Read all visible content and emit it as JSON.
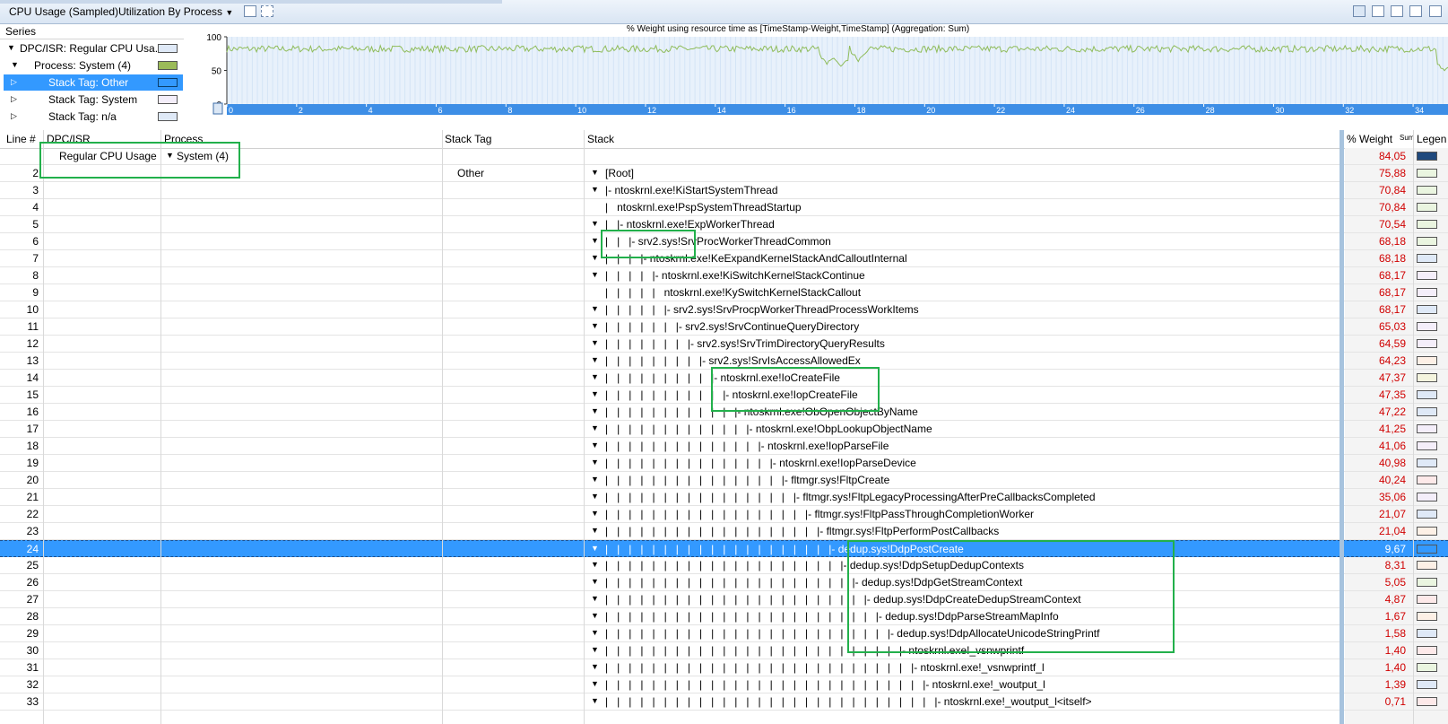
{
  "toolbar": {
    "graph_title": "CPU Usage (Sampled)",
    "preset": "Utilization By Process",
    "preset_arrow": "▼"
  },
  "series": {
    "header": "Series",
    "items": [
      {
        "label": "DPC/ISR: Regular CPU Usa...",
        "color": "#dfe9f7",
        "expander": "▼",
        "indent": 0
      },
      {
        "label": "Process: System (4)",
        "color": "#9bbb59",
        "expander": "▼",
        "indent": 1
      },
      {
        "label": "Stack Tag: Other",
        "color": "#3399ff",
        "expander": "▷",
        "indent": 2,
        "selected": true
      },
      {
        "label": "Stack Tag: System",
        "color": "#f4eefa",
        "expander": "▷",
        "indent": 2
      },
      {
        "label": "Stack Tag: n/a",
        "color": "#dfe9f7",
        "expander": "▷",
        "indent": 2
      }
    ]
  },
  "chart_data": {
    "type": "line",
    "title": "% Weight using resource time as [TimeStamp-Weight,TimeStamp] (Aggregation: Sum)",
    "ylim": [
      0,
      100
    ],
    "yticks": [
      0,
      50,
      100
    ],
    "xlim": [
      0,
      35
    ],
    "xticks": [
      0,
      2,
      4,
      6,
      8,
      10,
      12,
      14,
      16,
      18,
      20,
      22,
      24,
      26,
      28,
      30,
      32,
      34
    ],
    "line_color": "#8fbc5a",
    "baseline": 82,
    "dips": [
      {
        "x": 17.2,
        "y": 58
      },
      {
        "x": 17.6,
        "y": 52
      },
      {
        "x": 18.1,
        "y": 63
      },
      {
        "x": 34.9,
        "y": 45
      }
    ]
  },
  "columns": {
    "line": "Line #",
    "dpc": "DPC/ISR",
    "process": "Process",
    "stacktag": "Stack Tag",
    "stack": "Stack",
    "weight": "% Weight",
    "weight_sub": "Sum",
    "legend": "Legen"
  },
  "rows": [
    {
      "line": "",
      "dpc": "Regular CPU Usage",
      "process": "System (4)",
      "stacktag": "",
      "stack": "",
      "depth": 0,
      "exp": false,
      "weight": "84,05",
      "color": "#1f497d"
    },
    {
      "line": "2",
      "dpc": "",
      "process": "",
      "stacktag": "Other",
      "stack": "[Root]",
      "depth": 0,
      "exp": true,
      "weight": "75,88",
      "color": "#eaf5e0"
    },
    {
      "line": "3",
      "stack": "|- ntoskrnl.exe!KiStartSystemThread",
      "depth": 0,
      "exp": true,
      "weight": "70,84",
      "color": "#eaf5e0"
    },
    {
      "line": "4",
      "stack": "|   ntoskrnl.exe!PspSystemThreadStartup",
      "depth": 0,
      "exp": false,
      "weight": "70,84",
      "color": "#eaf5e0"
    },
    {
      "line": "5",
      "stack": "|   |- ntoskrnl.exe!ExpWorkerThread",
      "depth": 0,
      "exp": true,
      "weight": "70,54",
      "color": "#eaf5e0"
    },
    {
      "line": "6",
      "stack": "|   |   |- srv2.sys!SrvProcWorkerThreadCommon",
      "depth": 0,
      "exp": true,
      "weight": "68,18",
      "color": "#eaf5e0"
    },
    {
      "line": "7",
      "stack": "|   |   |   |- ntoskrnl.exe!KeExpandKernelStackAndCalloutInternal",
      "depth": 0,
      "exp": true,
      "weight": "68,18",
      "color": "#dfe9f7"
    },
    {
      "line": "8",
      "stack": "|   |   |   |   |- ntoskrnl.exe!KiSwitchKernelStackContinue",
      "depth": 0,
      "exp": true,
      "weight": "68,17",
      "color": "#f4eefa"
    },
    {
      "line": "9",
      "stack": "|   |   |   |   |   ntoskrnl.exe!KySwitchKernelStackCallout",
      "depth": 0,
      "exp": false,
      "weight": "68,17",
      "color": "#f4eefa"
    },
    {
      "line": "10",
      "stack": "|   |   |   |   |   |- srv2.sys!SrvProcpWorkerThreadProcessWorkItems",
      "depth": 0,
      "exp": true,
      "weight": "68,17",
      "color": "#dfe9f7"
    },
    {
      "line": "11",
      "stack": "|   |   |   |   |   |   |- srv2.sys!SrvContinueQueryDirectory",
      "depth": 0,
      "exp": true,
      "weight": "65,03",
      "color": "#f4eefa"
    },
    {
      "line": "12",
      "stack": "|   |   |   |   |   |   |   |- srv2.sys!SrvTrimDirectoryQueryResults",
      "depth": 0,
      "exp": true,
      "weight": "64,59",
      "color": "#f4eefa"
    },
    {
      "line": "13",
      "stack": "|   |   |   |   |   |   |   |   |- srv2.sys!SrvIsAccessAllowedEx",
      "depth": 0,
      "exp": true,
      "weight": "64,23",
      "color": "#fdf0e6"
    },
    {
      "line": "14",
      "stack": "|   |   |   |   |   |   |   |   |   |- ntoskrnl.exe!IoCreateFile",
      "depth": 0,
      "exp": true,
      "weight": "47,37",
      "color": "#f4f4de"
    },
    {
      "line": "15",
      "stack": "|   |   |   |   |   |   |   |   |   |   |- ntoskrnl.exe!IopCreateFile",
      "depth": 0,
      "exp": true,
      "weight": "47,35",
      "color": "#dfe9f7"
    },
    {
      "line": "16",
      "stack": "|   |   |   |   |   |   |   |   |   |   |   |- ntoskrnl.exe!ObOpenObjectByName",
      "depth": 0,
      "exp": true,
      "weight": "47,22",
      "color": "#dfe9f7"
    },
    {
      "line": "17",
      "stack": "|   |   |   |   |   |   |   |   |   |   |   |   |- ntoskrnl.exe!ObpLookupObjectName",
      "depth": 0,
      "exp": true,
      "weight": "41,25",
      "color": "#f4eefa"
    },
    {
      "line": "18",
      "stack": "|   |   |   |   |   |   |   |   |   |   |   |   |   |- ntoskrnl.exe!IopParseFile",
      "depth": 0,
      "exp": true,
      "weight": "41,06",
      "color": "#f4eefa"
    },
    {
      "line": "19",
      "stack": "|   |   |   |   |   |   |   |   |   |   |   |   |   |   |- ntoskrnl.exe!IopParseDevice",
      "depth": 0,
      "exp": true,
      "weight": "40,98",
      "color": "#dfe9f7"
    },
    {
      "line": "20",
      "stack": "|   |   |   |   |   |   |   |   |   |   |   |   |   |   |   |- fltmgr.sys!FltpCreate",
      "depth": 0,
      "exp": true,
      "weight": "40,24",
      "color": "#fde9e9"
    },
    {
      "line": "21",
      "stack": "|   |   |   |   |   |   |   |   |   |   |   |   |   |   |   |   |- fltmgr.sys!FltpLegacyProcessingAfterPreCallbacksCompleted",
      "depth": 0,
      "exp": true,
      "weight": "35,06",
      "color": "#f4eefa"
    },
    {
      "line": "22",
      "stack": "|   |   |   |   |   |   |   |   |   |   |   |   |   |   |   |   |   |- fltmgr.sys!FltpPassThroughCompletionWorker",
      "depth": 0,
      "exp": true,
      "weight": "21,07",
      "color": "#dfe9f7"
    },
    {
      "line": "23",
      "stack": "|   |   |   |   |   |   |   |   |   |   |   |   |   |   |   |   |   |   |- fltmgr.sys!FltpPerformPostCallbacks",
      "depth": 0,
      "exp": true,
      "weight": "21,04",
      "color": "#fdf0e6"
    },
    {
      "line": "24",
      "stack": "|   |   |   |   |   |   |   |   |   |   |   |   |   |   |   |   |   |   |   |- dedup.sys!DdpPostCreate",
      "depth": 0,
      "exp": true,
      "weight": "9,67",
      "color": "#3399ff",
      "selected": true
    },
    {
      "line": "25",
      "stack": "|   |   |   |   |   |   |   |   |   |   |   |   |   |   |   |   |   |   |   |   |- dedup.sys!DdpSetupDedupContexts",
      "depth": 0,
      "exp": true,
      "weight": "8,31",
      "color": "#fdf0e6"
    },
    {
      "line": "26",
      "stack": "|   |   |   |   |   |   |   |   |   |   |   |   |   |   |   |   |   |   |   |   |   |- dedup.sys!DdpGetStreamContext",
      "depth": 0,
      "exp": true,
      "weight": "5,05",
      "color": "#eaf5e0"
    },
    {
      "line": "27",
      "stack": "|   |   |   |   |   |   |   |   |   |   |   |   |   |   |   |   |   |   |   |   |   |   |- dedup.sys!DdpCreateDedupStreamContext",
      "depth": 0,
      "exp": true,
      "weight": "4,87",
      "color": "#fde9e9"
    },
    {
      "line": "28",
      "stack": "|   |   |   |   |   |   |   |   |   |   |   |   |   |   |   |   |   |   |   |   |   |   |   |- dedup.sys!DdpParseStreamMapInfo",
      "depth": 0,
      "exp": true,
      "weight": "1,67",
      "color": "#fdf0e6"
    },
    {
      "line": "29",
      "stack": "|   |   |   |   |   |   |   |   |   |   |   |   |   |   |   |   |   |   |   |   |   |   |   |   |- dedup.sys!DdpAllocateUnicodeStringPrintf",
      "depth": 0,
      "exp": true,
      "weight": "1,58",
      "color": "#dfe9f7"
    },
    {
      "line": "30",
      "stack": "|   |   |   |   |   |   |   |   |   |   |   |   |   |   |   |   |   |   |   |   |   |   |   |   |   |- ntoskrnl.exe!_vsnwprintf",
      "depth": 0,
      "exp": true,
      "weight": "1,40",
      "color": "#fde9e9"
    },
    {
      "line": "31",
      "stack": "|   |   |   |   |   |   |   |   |   |   |   |   |   |   |   |   |   |   |   |   |   |   |   |   |   |   |- ntoskrnl.exe!_vsnwprintf_l",
      "depth": 0,
      "exp": true,
      "weight": "1,40",
      "color": "#eaf5e0"
    },
    {
      "line": "32",
      "stack": "|   |   |   |   |   |   |   |   |   |   |   |   |   |   |   |   |   |   |   |   |   |   |   |   |   |   |   |- ntoskrnl.exe!_woutput_l",
      "depth": 0,
      "exp": true,
      "weight": "1,39",
      "color": "#dfe9f7"
    },
    {
      "line": "33",
      "stack": "|   |   |   |   |   |   |   |   |   |   |   |   |   |   |   |   |   |   |   |   |   |   |   |   |   |   |   |   |- ntoskrnl.exe!_woutput_l<itself>",
      "depth": 0,
      "exp": true,
      "weight": "0,71",
      "color": "#fde9e9"
    }
  ],
  "icons": [
    "options-icon",
    "table-mode-icon",
    "graph-mode-icon",
    "graph-table-icon",
    "settings-icon",
    "close-icon"
  ]
}
